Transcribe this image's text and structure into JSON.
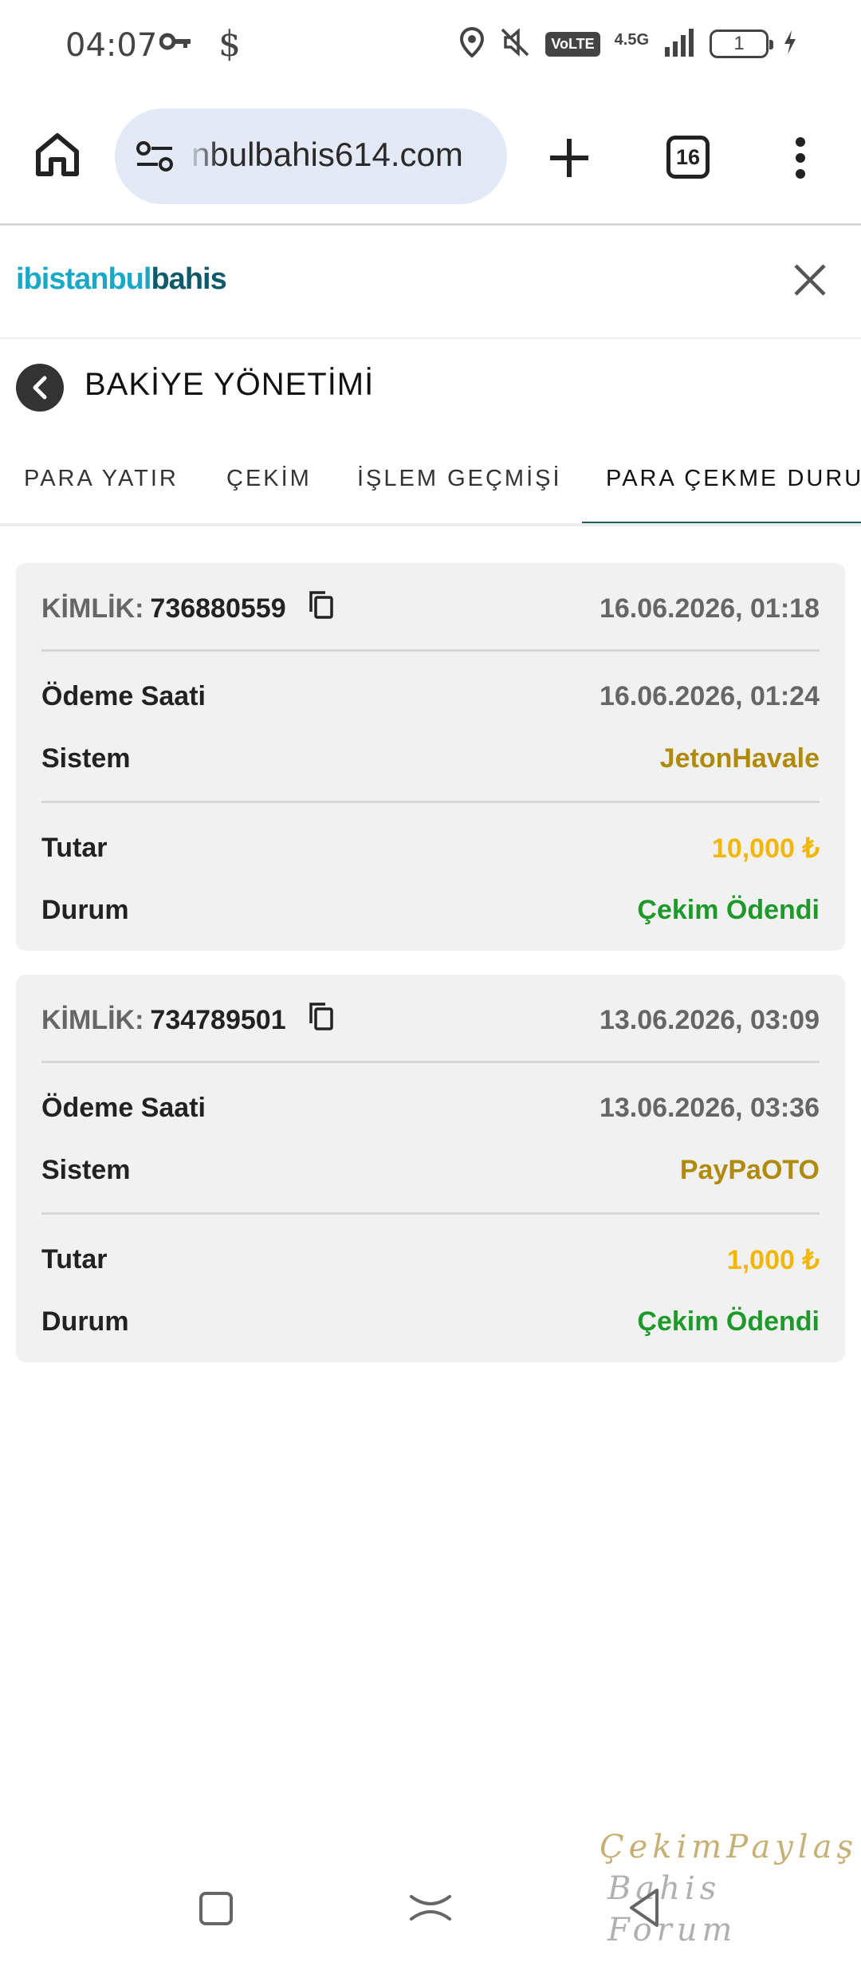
{
  "status_bar": {
    "time": "04:07",
    "dollar_symbol": "$",
    "volte": "VoLTE",
    "network": "4.5G",
    "battery": "1"
  },
  "browser": {
    "url": "nbulbahis614.com",
    "tab_count": "16"
  },
  "site": {
    "logo_ib": "ib",
    "logo_istanbul": "istanbul",
    "logo_bahis": "bahis",
    "colors": {
      "logo_light": "#1aa8c8",
      "logo_dark": "#0f5a6a"
    }
  },
  "page": {
    "title": "BAKİYE YÖNETİMİ"
  },
  "tabs": [
    {
      "label": "PARA YATIR"
    },
    {
      "label": "ÇEKİM"
    },
    {
      "label": "İŞLEM GEÇMİŞİ"
    },
    {
      "label": "PARA ÇEKME DURU",
      "active": true
    }
  ],
  "labels": {
    "kimlik": "KİMLİK:",
    "payment_time": "Ödeme Saati",
    "system": "Sistem",
    "amount": "Tutar",
    "status": "Durum"
  },
  "withdrawals": [
    {
      "id": "736880559",
      "created": "16.06.2026, 01:18",
      "payment_time": "16.06.2026, 01:24",
      "system": "JetonHavale",
      "amount": "10,000 ₺",
      "status": "Çekim Ödendi"
    },
    {
      "id": "734789501",
      "created": "13.06.2026, 03:09",
      "payment_time": "13.06.2026, 03:36",
      "system": "PayPaOTO",
      "amount": "1,000 ₺",
      "status": "Çekim Ödendi"
    }
  ],
  "colors": {
    "system": "#b08a0a",
    "amount": "#f2b705",
    "status_paid": "#1e9a2a",
    "tab_indicator": "#1b5e5a"
  },
  "watermark": {
    "line1": "ÇekimPaylaş",
    "line2": "Bahis Forum"
  }
}
